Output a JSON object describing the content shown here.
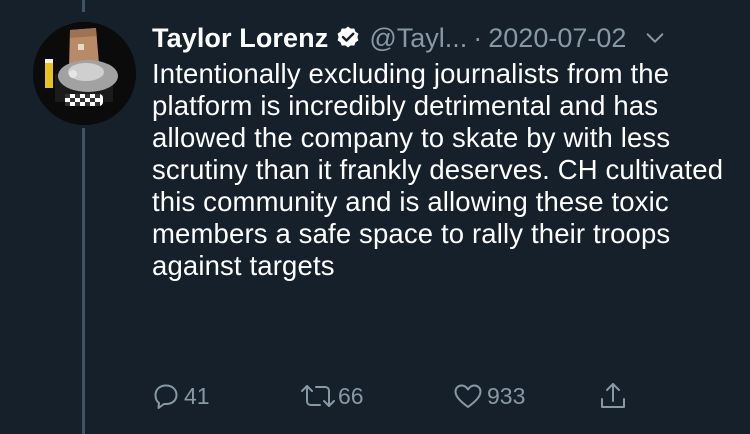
{
  "tweet": {
    "author_name": "Taylor Lorenz",
    "handle": "@Tayl...",
    "separator": "·",
    "date": "2020-07-02",
    "text": "Intentionally excluding journalists from the platform is incredibly detrimental and has allowed the company to skate by with less scrutiny than it frankly deserves. CH cultivated this community and is allowing these toxic members a safe space to rally their troops against targets"
  },
  "actions": {
    "reply_count": "41",
    "retweet_count": "66",
    "like_count": "933"
  },
  "icons": {
    "verified": "verified-badge-icon",
    "menu": "chevron-down-icon",
    "reply": "reply-icon",
    "retweet": "retweet-icon",
    "like": "heart-icon",
    "share": "share-icon"
  },
  "colors": {
    "background": "#15202b",
    "text_primary": "#ffffff",
    "text_secondary": "#8899a6",
    "thread_line": "#3d5466"
  }
}
